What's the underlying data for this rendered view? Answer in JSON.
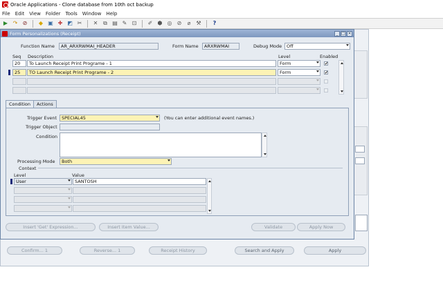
{
  "window": {
    "title": "Oracle Applications - Clone database from 10th oct backup"
  },
  "menu": [
    "File",
    "Edit",
    "View",
    "Folder",
    "Tools",
    "Window",
    "Help"
  ],
  "toolbar_icons": [
    "open-icon",
    "save-icon",
    "next-icon",
    "new-record-icon",
    "find-icon",
    "print-icon",
    "cut-icon",
    "copy-icon",
    "paste-icon",
    "clear-icon",
    "delete-icon",
    "edit-icon",
    "zoom-icon",
    "translate-icon",
    "attachment-icon",
    "folder-icon",
    "help-icon"
  ],
  "form": {
    "title": "Form Personalizations (Receipt)",
    "function_label": "Function Name",
    "function_value": "AR_ARXRWMAI_HEADER",
    "formname_label": "Form Name",
    "formname_value": "ARXRWMAI",
    "debug_label": "Debug Mode",
    "debug_value": "Off",
    "grid_headers": {
      "seq": "Seq",
      "description": "Description",
      "level": "Level",
      "enabled": "Enabled"
    },
    "rows": [
      {
        "seq": "20",
        "description": "To Launch Receipt Print Programe - 1",
        "level": "Form",
        "enabled": "✔"
      },
      {
        "seq": "25",
        "description": "TO Launch Receipt Print Programe - 2",
        "level": "Form",
        "enabled": "✔"
      },
      {
        "seq": "",
        "description": "",
        "level": "",
        "enabled": ""
      },
      {
        "seq": "",
        "description": "",
        "level": "",
        "enabled": ""
      }
    ],
    "tabs": [
      "Condition",
      "Actions"
    ],
    "trigger_event_label": "Trigger Event",
    "trigger_event_value": "SPECIAL45",
    "trigger_hint": "(You can enter additional event names.)",
    "trigger_object_label": "Trigger Object",
    "condition_label": "Condition",
    "processing_mode_label": "Processing Mode",
    "processing_mode_value": "Both",
    "context_label": "Context",
    "context_headers": {
      "level": "Level",
      "value": "Value"
    },
    "context_rows": [
      {
        "level": "User",
        "value": "SANTOSH"
      },
      {
        "level": "",
        "value": ""
      },
      {
        "level": "",
        "value": ""
      },
      {
        "level": "",
        "value": ""
      }
    ],
    "buttons": {
      "insert_get": "Insert 'Get' Expression...",
      "insert_item": "Insert Item Value...",
      "validate": "Validate",
      "apply_now": "Apply Now"
    }
  },
  "bottom_buttons": {
    "confirm": "Confirm... 1",
    "reverse": "Reverse... 1",
    "receipt_history": "Receipt History",
    "search_apply": "Search and Apply",
    "apply": "Apply"
  }
}
